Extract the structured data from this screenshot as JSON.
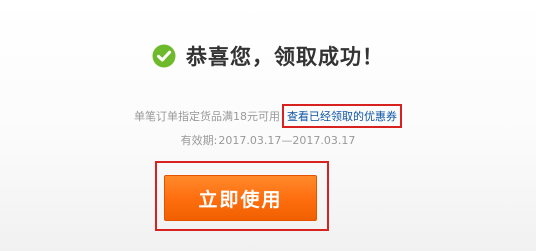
{
  "success": {
    "title": "恭喜您，领取成功！",
    "icon": "check-circle-icon",
    "icon_color": "#6fba2c"
  },
  "info": {
    "condition_text": "单笔订单指定货品满18元可用",
    "view_link_label": "查看已经领取的优惠券"
  },
  "validity": {
    "label": "有效期:",
    "range": "2017.03.17—2017.03.17"
  },
  "action": {
    "use_button_label": "立即使用",
    "button_color": "#ff6f10"
  },
  "annotation_color": "#d8221f"
}
